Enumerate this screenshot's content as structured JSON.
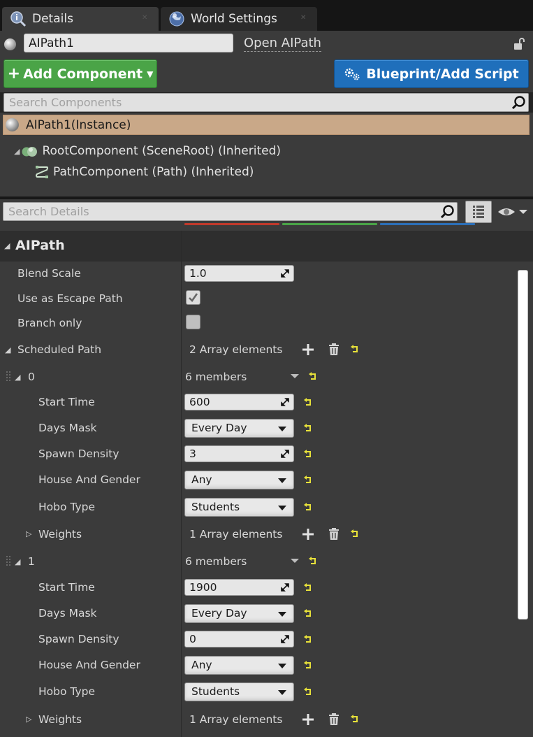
{
  "tabs": [
    {
      "label": "Details",
      "icon": "details-magnifier-icon",
      "active": true
    },
    {
      "label": "World Settings",
      "icon": "globe-icon",
      "active": false
    }
  ],
  "actor": {
    "name": "AIPath1",
    "open_link": "Open AIPath"
  },
  "buttons": {
    "add_component": "Add Component",
    "blueprint": "Blueprint/Add Script"
  },
  "components": {
    "search_placeholder": "Search Components",
    "instance": "AIPath1(Instance)",
    "root": "RootComponent (SceneRoot) (Inherited)",
    "child": "PathComponent (Path) (Inherited)"
  },
  "details": {
    "search_placeholder": "Search Details",
    "category": "AIPath",
    "blend_scale_label": "Blend Scale",
    "blend_scale_value": "1.0",
    "escape_label": "Use as Escape Path",
    "escape_checked": true,
    "branch_label": "Branch only",
    "branch_checked": false,
    "scheduled_label": "Scheduled Path",
    "scheduled_value": "2 Array elements",
    "elements": [
      {
        "index": "0",
        "members": "6 members",
        "start_time_label": "Start Time",
        "start_time": "600",
        "days_mask_label": "Days Mask",
        "days_mask": "Every Day",
        "spawn_density_label": "Spawn Density",
        "spawn_density": "3",
        "house_gender_label": "House And Gender",
        "house_gender": "Any",
        "hobo_type_label": "Hobo Type",
        "hobo_type": "Students",
        "weights_label": "Weights",
        "weights_value": "1 Array elements"
      },
      {
        "index": "1",
        "members": "6 members",
        "start_time_label": "Start Time",
        "start_time": "1900",
        "days_mask_label": "Days Mask",
        "days_mask": "Every Day",
        "spawn_density_label": "Spawn Density",
        "spawn_density": "0",
        "house_gender_label": "House And Gender",
        "house_gender": "Any",
        "hobo_type_label": "Hobo Type",
        "hobo_type": "Students",
        "weights_label": "Weights",
        "weights_value": "1 Array elements"
      }
    ]
  },
  "colors": {
    "add_green": "#4aa447",
    "blueprint_blue": "#1f6fbb",
    "instance_tan": "#c9a888",
    "reset_yellow": "#e8e23a"
  }
}
